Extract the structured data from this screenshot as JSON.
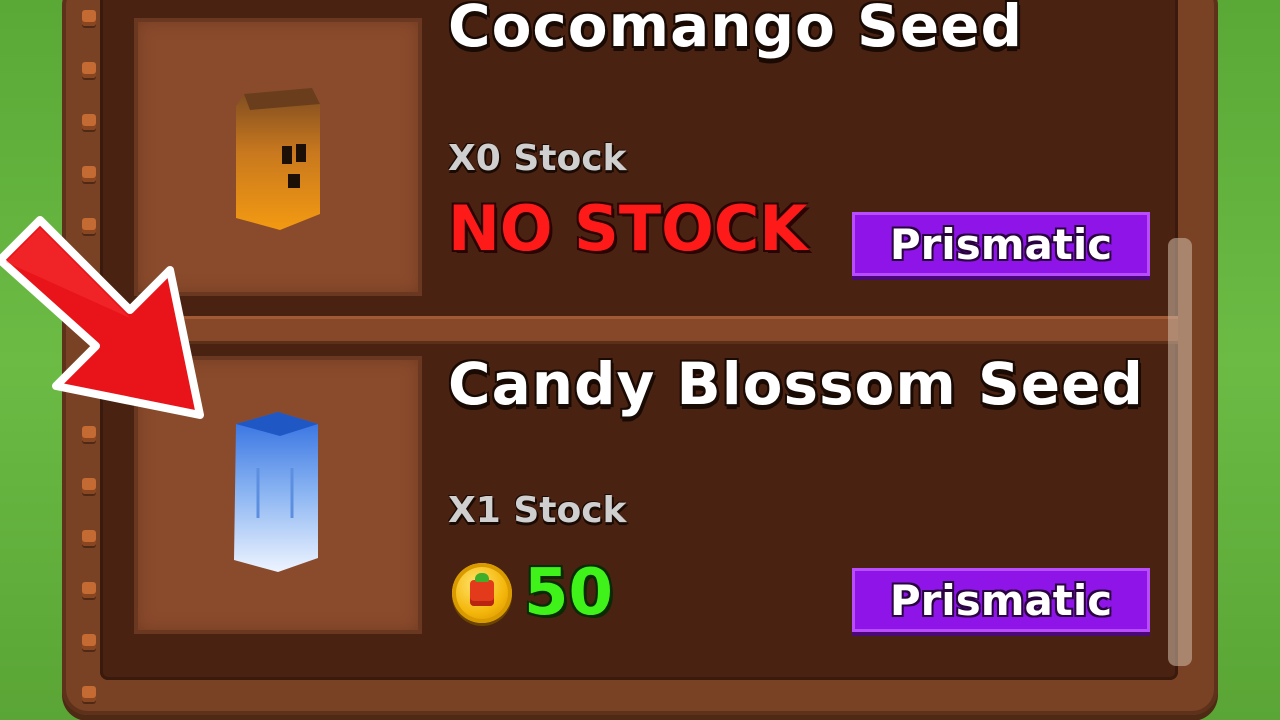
{
  "colors": {
    "background": "#5aa836",
    "frame": "#7a4224",
    "panel": "#4a2212",
    "thumb": "#8a4a2c",
    "no_stock": "#ff1a1a",
    "price": "#3ff21a",
    "badge": "#8e14e8",
    "arrow": "#e8141a"
  },
  "items": [
    {
      "name": "Cocomango Seed",
      "stock": "X0 Stock",
      "status": "NO STOCK",
      "rarity": "Prismatic",
      "icon": "cocomango-seed-pack-icon"
    },
    {
      "name": "Candy Blossom Seed",
      "stock": "X1 Stock",
      "price": "50",
      "rarity": "Prismatic",
      "icon": "candy-blossom-seed-pack-icon",
      "currency_icon": "sheckle-coin-icon"
    }
  ],
  "overlay": {
    "icon": "red-pointer-arrow-icon"
  }
}
